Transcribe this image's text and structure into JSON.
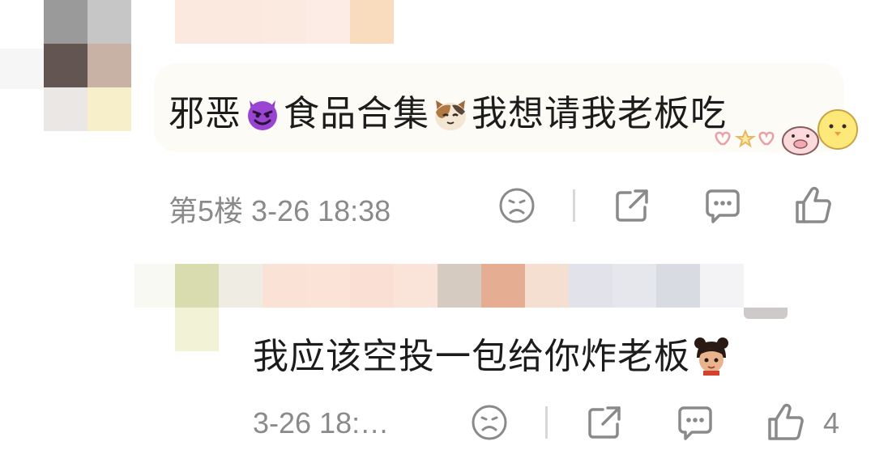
{
  "comments": [
    {
      "text_parts": [
        "邪恶",
        "食品合集",
        "我想请我老板吃"
      ],
      "emoji": [
        "devil-emoji",
        "cat-emoji"
      ],
      "floor": "第5楼",
      "timestamp": "3-26 18:38",
      "like_count": ""
    },
    {
      "text": "我应该空投一包给你炸老板",
      "emoji": [
        "girl-emoji"
      ],
      "timestamp": "3-26 18:…",
      "like_count": "4"
    }
  ],
  "colors": {
    "meta_text": "#8a8a8a",
    "icon_stroke": "#8a8a8a",
    "bubble": "#fcfbf6"
  }
}
